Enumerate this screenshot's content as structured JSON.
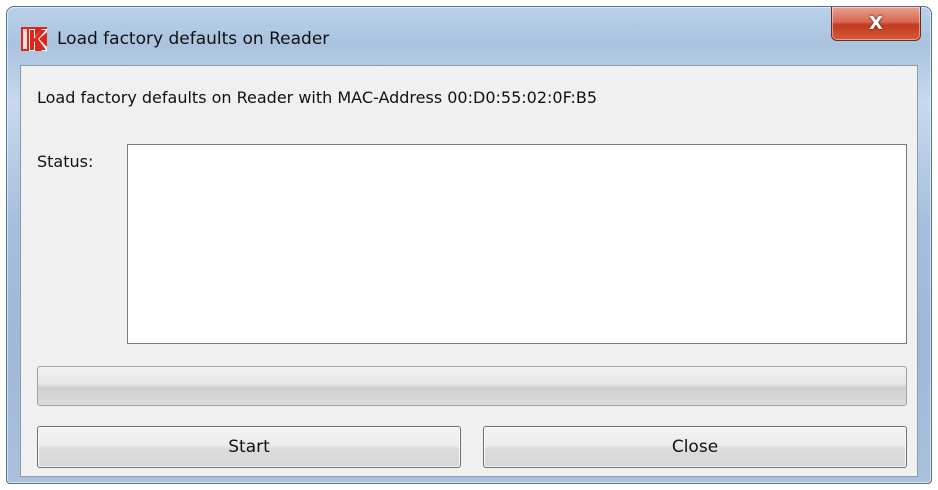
{
  "window": {
    "title": "Load factory defaults on Reader",
    "close_glyph": "X",
    "icon": "app-logo-icon",
    "accent_color": "#e0251b"
  },
  "main": {
    "info_text": "Load factory defaults on Reader with MAC-Address 00:D0:55:02:0F:B5",
    "status_label": "Status:",
    "status_value": "",
    "progress_fraction": 0
  },
  "buttons": {
    "start_label": "Start",
    "close_label": "Close"
  }
}
